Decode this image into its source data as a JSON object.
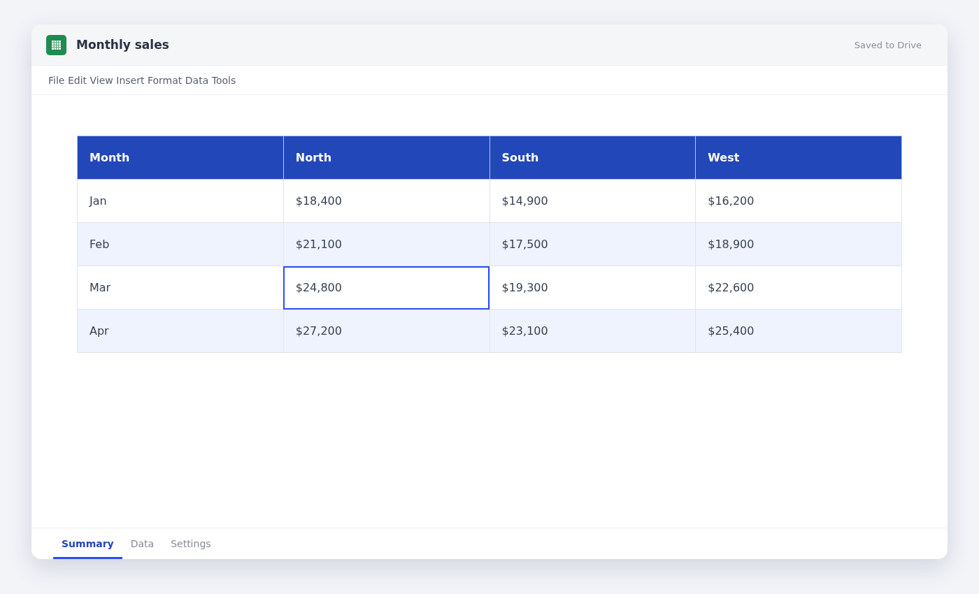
{
  "window": {
    "title": "Monthly sales",
    "status": "Saved to Drive"
  },
  "menu": [
    "File",
    "Edit",
    "View",
    "Insert",
    "Format",
    "Data",
    "Tools"
  ],
  "table": {
    "columns": [
      "Month",
      "North",
      "South",
      "West"
    ],
    "rows": [
      {
        "cells": [
          {
            "text": "Jan",
            "selected": false
          },
          {
            "text": "$18,400",
            "selected": false
          },
          {
            "text": "$14,900",
            "selected": false
          },
          {
            "text": "$16,200",
            "selected": false
          }
        ]
      },
      {
        "cells": [
          {
            "text": "Feb",
            "selected": false
          },
          {
            "text": "$21,100",
            "selected": false
          },
          {
            "text": "$17,500",
            "selected": false
          },
          {
            "text": "$18,900",
            "selected": false
          }
        ]
      },
      {
        "cells": [
          {
            "text": "Mar",
            "selected": false
          },
          {
            "text": "$24,800",
            "selected": true
          },
          {
            "text": "$19,300",
            "selected": false
          },
          {
            "text": "$22,600",
            "selected": false
          }
        ]
      },
      {
        "cells": [
          {
            "text": "Apr",
            "selected": false
          },
          {
            "text": "$27,200",
            "selected": false
          },
          {
            "text": "$23,100",
            "selected": false
          },
          {
            "text": "$25,400",
            "selected": false
          }
        ]
      }
    ]
  },
  "tabs": [
    {
      "label": "Summary",
      "selected": true
    },
    {
      "label": "Data",
      "selected": false
    },
    {
      "label": "Settings",
      "selected": false
    }
  ]
}
